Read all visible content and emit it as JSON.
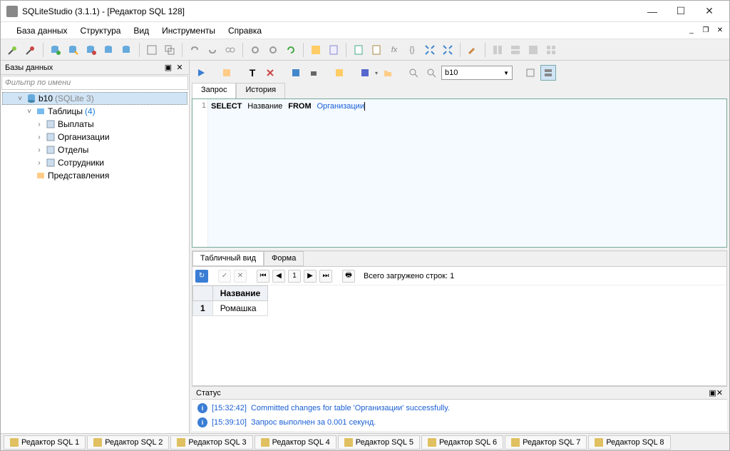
{
  "window": {
    "title": "SQLiteStudio (3.1.1) - [Редактор SQL 128]"
  },
  "menu": {
    "items": [
      "База данных",
      "Структура",
      "Вид",
      "Инструменты",
      "Справка"
    ]
  },
  "sidebar": {
    "header": "Базы данных",
    "filter_placeholder": "Фильтр по имени",
    "db_name": "b10",
    "db_type": "(SQLite 3)",
    "tables_label": "Таблицы",
    "tables_count": "(4)",
    "tables": [
      "Выплаты",
      "Организации",
      "Отделы",
      "Сотрудники"
    ],
    "views_label": "Представления"
  },
  "editor": {
    "combo_value": "b10",
    "tabs": {
      "query": "Запрос",
      "history": "История"
    },
    "sql": {
      "line_num": "1",
      "keyword_select": "SELECT",
      "col": "Название",
      "keyword_from": "FROM",
      "table": "Организации"
    }
  },
  "results": {
    "tabs": {
      "tabular": "Табличный вид",
      "form": "Форма"
    },
    "page": "1",
    "loaded_label": "Всего загружено строк: 1",
    "header": "Название",
    "row_num": "1",
    "row_value": "Ромашка"
  },
  "status": {
    "header": "Статус",
    "rows": [
      {
        "time": "[15:32:42]",
        "msg": "Committed changes for table 'Организации' successfully."
      },
      {
        "time": "[15:39:10]",
        "msg": "Запрос выполнен за 0.001 секунд."
      }
    ]
  },
  "bottom_tabs": [
    "Редактор SQL 1",
    "Редактор SQL 2",
    "Редактор SQL 3",
    "Редактор SQL 4",
    "Редактор SQL 5",
    "Редактор SQL 6",
    "Редактор SQL 7",
    "Редактор SQL 8"
  ]
}
